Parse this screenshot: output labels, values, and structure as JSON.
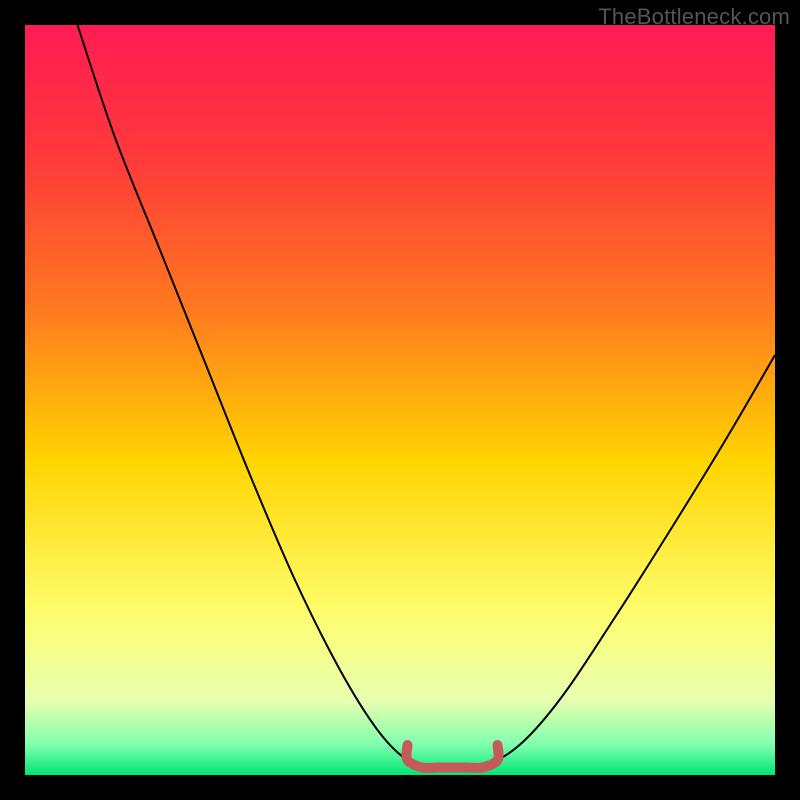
{
  "watermark": "TheBottleneck.com",
  "chart_data": {
    "type": "line",
    "title": "",
    "xlabel": "",
    "ylabel": "",
    "xlim": [
      0,
      100
    ],
    "ylim": [
      0,
      100
    ],
    "background_gradient": {
      "stops": [
        {
          "offset": 0.0,
          "color": "#ff1b54"
        },
        {
          "offset": 0.18,
          "color": "#ff3a3a"
        },
        {
          "offset": 0.38,
          "color": "#ff7a1f"
        },
        {
          "offset": 0.58,
          "color": "#ffd400"
        },
        {
          "offset": 0.78,
          "color": "#fffd6b"
        },
        {
          "offset": 0.9,
          "color": "#e8ffb0"
        },
        {
          "offset": 0.96,
          "color": "#7fffad"
        },
        {
          "offset": 1.0,
          "color": "#00e676"
        }
      ]
    },
    "series": [
      {
        "name": "bottleneck-curve",
        "color": "#000000",
        "points": [
          {
            "x": 7,
            "y": 100
          },
          {
            "x": 12,
            "y": 85
          },
          {
            "x": 18,
            "y": 70
          },
          {
            "x": 24,
            "y": 55
          },
          {
            "x": 30,
            "y": 40
          },
          {
            "x": 36,
            "y": 26
          },
          {
            "x": 42,
            "y": 14
          },
          {
            "x": 47,
            "y": 6
          },
          {
            "x": 51,
            "y": 2
          },
          {
            "x": 55,
            "y": 1
          },
          {
            "x": 59,
            "y": 1
          },
          {
            "x": 63,
            "y": 2
          },
          {
            "x": 67,
            "y": 5
          },
          {
            "x": 72,
            "y": 11
          },
          {
            "x": 78,
            "y": 20
          },
          {
            "x": 85,
            "y": 31
          },
          {
            "x": 93,
            "y": 44
          },
          {
            "x": 100,
            "y": 56
          }
        ]
      },
      {
        "name": "optimal-zone-marker",
        "color": "#c65a5a",
        "thick": true,
        "points": [
          {
            "x": 51,
            "y": 4
          },
          {
            "x": 51,
            "y": 2
          },
          {
            "x": 53,
            "y": 1
          },
          {
            "x": 55,
            "y": 1
          },
          {
            "x": 57,
            "y": 1
          },
          {
            "x": 59,
            "y": 1
          },
          {
            "x": 61,
            "y": 1
          },
          {
            "x": 63,
            "y": 2
          },
          {
            "x": 63,
            "y": 4
          }
        ]
      }
    ]
  }
}
